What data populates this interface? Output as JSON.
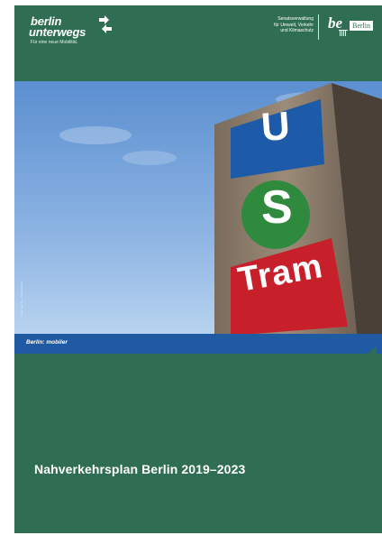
{
  "brand": {
    "line1": "berlin",
    "line2": "unterwegs",
    "tagline": "Für eine neue Mobilität."
  },
  "senate": {
    "line1": "Senatsverwaltung",
    "line2": "für Umwelt, Verkehr",
    "line3": "und Klimaschutz",
    "be_logo": "be",
    "berlin_label": "Berlin"
  },
  "photo": {
    "sign_top": "U",
    "sign_middle": "S",
    "sign_bottom": "Tram",
    "credit": "Foto: Agentur • Bildnachweis"
  },
  "band": {
    "text": "Berlin: mobiler"
  },
  "title": "Nahverkehrsplan Berlin 2019–2023",
  "colors": {
    "cover_green": "#2f6e52",
    "band_blue": "#1f5aa2",
    "u_blue": "#1d5aa8",
    "s_green": "#2f8a3e",
    "tram_red": "#c8202a"
  }
}
